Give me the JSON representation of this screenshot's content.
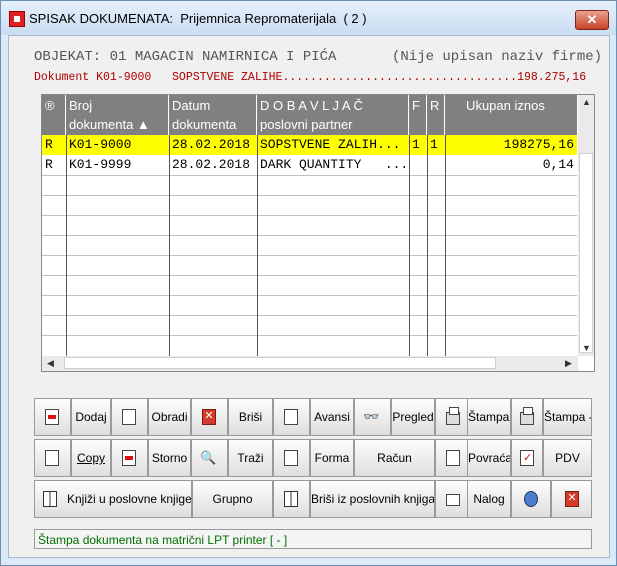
{
  "window": {
    "title": "SPISAK DOKUMENATA:  Prijemnica Repromaterijala  ( 2 )",
    "close_label": "✕"
  },
  "header": {
    "objekat": "OBJEKAT: 01 MAGACIN NAMIRNICA I PIĆA",
    "firma": "(Nije upisan naziv firme)",
    "dokument_line": "Dokument K01-9000   SOPSTVENE ZALIHE..................................198.275,16"
  },
  "grid": {
    "columns": [
      {
        "line1": "®",
        "line2": ""
      },
      {
        "line1": "Broj",
        "line2": "dokumenta ▲"
      },
      {
        "line1": "Datum",
        "line2": "dokumenta"
      },
      {
        "line1": "D O B A V L J A Č",
        "line2": "poslovni partner"
      },
      {
        "line1": "F",
        "line2": ""
      },
      {
        "line1": "R",
        "line2": ""
      },
      {
        "line1": "     Ukupan iznos",
        "line2": ""
      }
    ],
    "rows": [
      {
        "status": "R",
        "broj": "K01-9000",
        "datum": "28.02.2018",
        "partner": "SOPSTVENE ZALIH...",
        "f": "1",
        "r": "1",
        "iznos": "198275,16",
        "selected": true
      },
      {
        "status": "R",
        "broj": "K01-9999",
        "datum": "28.02.2018",
        "partner": "DARK QUANTITY   ...",
        "f": "",
        "r": "",
        "iznos": "0,14",
        "selected": false
      }
    ]
  },
  "buttons": {
    "dodaj": "Dodaj",
    "obradi": "Obradi",
    "brisi": "Briši",
    "avansi": "Avansi",
    "pregled": "Pregled",
    "stampa_plus": "Štampa +",
    "stampa_minus": "Štampa -",
    "copy": "Copy",
    "storno": "Storno",
    "trazi": "Traži",
    "forma": "Forma",
    "racun": "Račun",
    "povracaj": "Povraćaj",
    "pdv": "PDV",
    "knjizi": "Knjiži u poslovne knjige *",
    "grupno": "Grupno",
    "brisi_knjiga": "Briši iz poslovnih knjiga",
    "nalog": "Nalog"
  },
  "status": {
    "text": "Štampa dokumenta na matrični LPT printer [ - ]"
  },
  "colors": {
    "selected_row": "#ffff00",
    "header_bg": "#808080",
    "document_line": "#b00000",
    "status_text": "#007000"
  }
}
